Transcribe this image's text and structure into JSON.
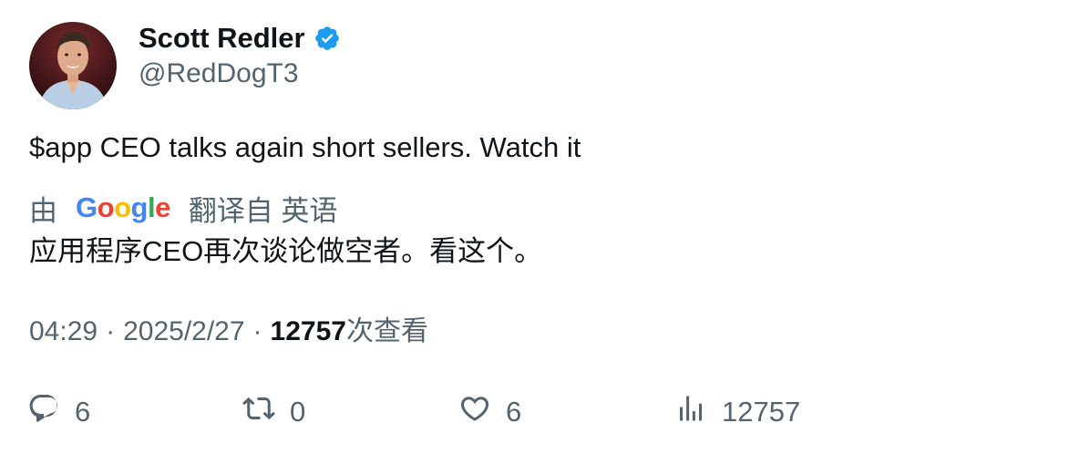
{
  "author": {
    "display_name": "Scott Redler",
    "handle": "@RedDogT3",
    "verified": true
  },
  "tweet": {
    "text": "$app CEO talks again short sellers. Watch it",
    "translation_prefix": "由",
    "translation_brand": "Google",
    "translation_suffix": "翻译自 英语",
    "translated_text": "应用程序CEO再次谈论做空者。看这个。"
  },
  "meta": {
    "time": "04:29",
    "date": "2025/2/27",
    "separator": "·",
    "views_count": "12757",
    "views_label": "次查看"
  },
  "actions": {
    "replies": "6",
    "retweets": "0",
    "likes": "6",
    "views": "12757"
  },
  "colors": {
    "verified_blue": "#1d9bf0",
    "secondary_text": "#536471",
    "primary_text": "#0f1419"
  }
}
